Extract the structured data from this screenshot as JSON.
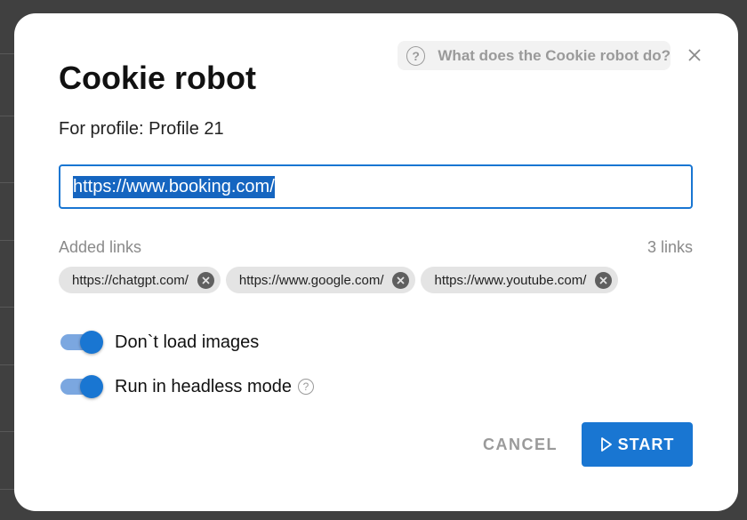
{
  "dialog": {
    "title": "Cookie robot",
    "help_link": "What does the Cookie robot do?",
    "profile_text": "For profile: Profile 21",
    "url_input_value": "https://www.booking.com/",
    "added_links_label": "Added links",
    "links_count": "3 links",
    "links": [
      "https://chatgpt.com/",
      "https://www.google.com/",
      "https://www.youtube.com/"
    ],
    "options": [
      {
        "label": "Don`t load images",
        "enabled": true
      },
      {
        "label": "Run in headless mode",
        "enabled": true
      }
    ],
    "cancel_label": "CANCEL",
    "start_label": "START"
  },
  "colors": {
    "accent": "#1976d2",
    "toggle_track": "#7ba7e0",
    "chip_bg": "#e4e4e4",
    "muted_text": "#8a8a8a",
    "overlay": "#404040"
  },
  "icons": {
    "help": "help-circle-icon",
    "close": "close-icon",
    "chip_remove": "remove-circle-icon",
    "start": "play-icon"
  }
}
